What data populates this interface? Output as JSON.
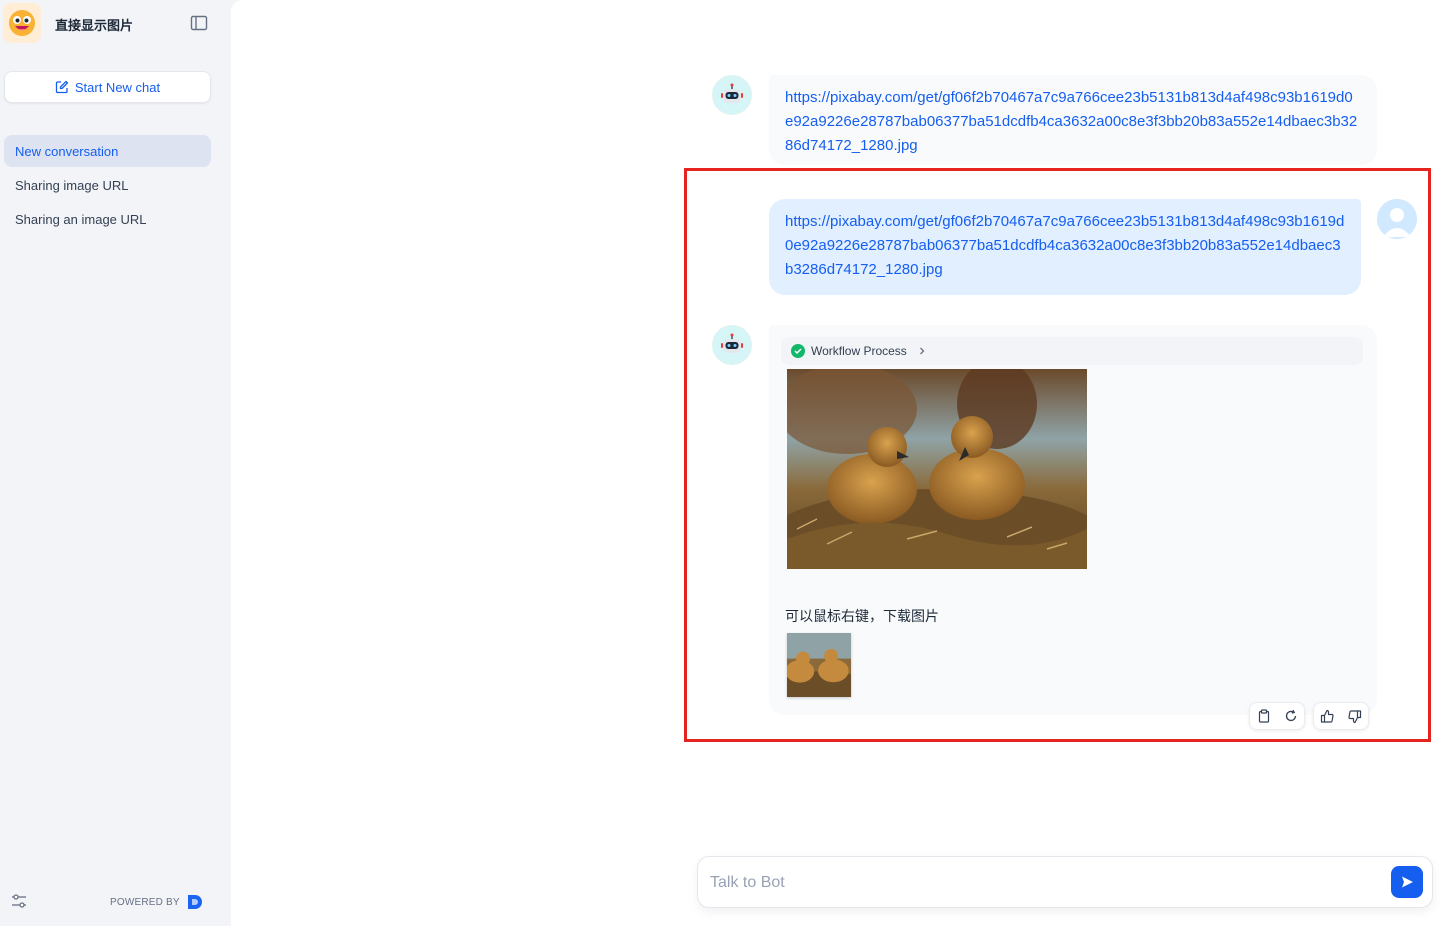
{
  "app": {
    "title": "直接显示图片"
  },
  "sidebar": {
    "new_chat_label": "Start New chat",
    "conversations": [
      {
        "label": "New conversation",
        "active": true
      },
      {
        "label": "Sharing image URL",
        "active": false
      },
      {
        "label": "Sharing an image URL",
        "active": false
      }
    ],
    "powered_by": "POWERED BY"
  },
  "chat": {
    "messages": [
      {
        "role": "bot",
        "text": "https://pixabay.com/get/gf06f2b70467a7c9a766cee23b5131b813d4af498c93b1619d0e92a9226e28787bab06377ba51dcdfb4ca3632a00c8e3f3bb20b83a552e14dbaec3b3286d74172_1280.jpg"
      },
      {
        "role": "user",
        "text": "https://pixabay.com/get/gf06f2b70467a7c9a766cee23b5131b813d4af498c93b1619d0e92a9226e28787bab06377ba51dcdfb4ca3632a00c8e3f3bb20b83a552e14dbaec3b3286d74172_1280.jpg"
      },
      {
        "role": "bot",
        "workflow_label": "Workflow Process",
        "caption": "可以鼠标右键，下载图片"
      }
    ]
  },
  "input": {
    "placeholder": "Talk to Bot"
  },
  "colors": {
    "accent": "#155eef",
    "highlight": "#e52420",
    "sidebar_bg": "#f2f4f7"
  }
}
